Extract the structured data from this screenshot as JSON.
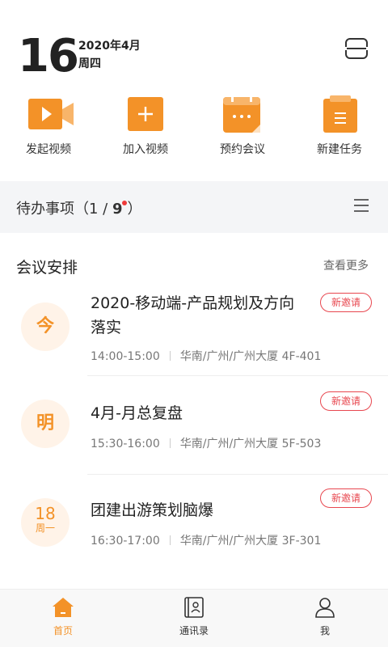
{
  "header": {
    "day": "16",
    "year_month": "2020年4月",
    "weekday": "周四"
  },
  "quick_actions": [
    {
      "label": "发起视频",
      "icon": "video-camera-icon"
    },
    {
      "label": "加入视频",
      "icon": "plus-square-icon"
    },
    {
      "label": "预约会议",
      "icon": "calendar-dots-icon"
    },
    {
      "label": "新建任务",
      "icon": "task-list-icon"
    }
  ],
  "todo": {
    "label": "待办事项",
    "open_paren": "（",
    "done": "1",
    "slash": " / ",
    "total": "9",
    "close_paren": "）"
  },
  "meetings": {
    "title": "会议安排",
    "more": "查看更多",
    "items": [
      {
        "day": "今",
        "title": "2020-移动端-产品规划及方向落实",
        "time": "14:00-15:00",
        "location": "华南/广州/广州大厦 4F-401",
        "badge": "新邀请"
      },
      {
        "day": "明",
        "title": "4月-月总复盘",
        "time": "15:30-16:00",
        "location": "华南/广州/广州大厦 5F-503",
        "badge": "新邀请"
      },
      {
        "day_num": "18",
        "day_sub": "周一",
        "title": "团建出游策划脑爆",
        "time": "16:30-17:00",
        "location": "华南/广州/广州大厦 3F-301",
        "badge": "新邀请"
      }
    ]
  },
  "tabbar": {
    "items": [
      {
        "label": "首页",
        "icon": "home-icon",
        "active": true
      },
      {
        "label": "通讯录",
        "icon": "contacts-book-icon",
        "active": false
      },
      {
        "label": "我",
        "icon": "user-icon",
        "active": false
      }
    ]
  },
  "colors": {
    "accent": "#f39228",
    "invite": "#e8474f",
    "section_bg": "#f4f5f7"
  }
}
